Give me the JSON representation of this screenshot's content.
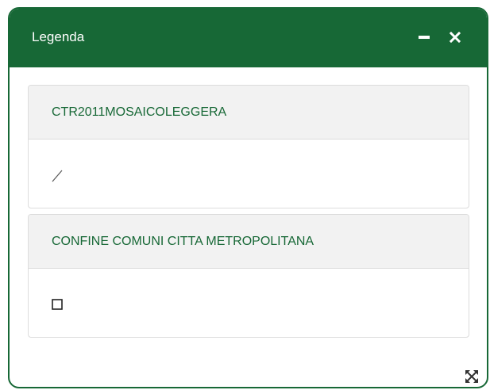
{
  "window": {
    "title": "Legenda",
    "accent_color": "#176836"
  },
  "header": {
    "minimize_icon": "minimize-icon",
    "close_icon": "close-icon"
  },
  "layers": [
    {
      "name": "CTR2011MOSAICOLEGGERA",
      "symbol_icon": "line-symbol-icon"
    },
    {
      "name": "CONFINE COMUNI CITTA METROPOLITANA",
      "symbol_icon": "polygon-symbol-icon"
    }
  ],
  "footer": {
    "resize_icon": "expand-arrows-icon"
  }
}
